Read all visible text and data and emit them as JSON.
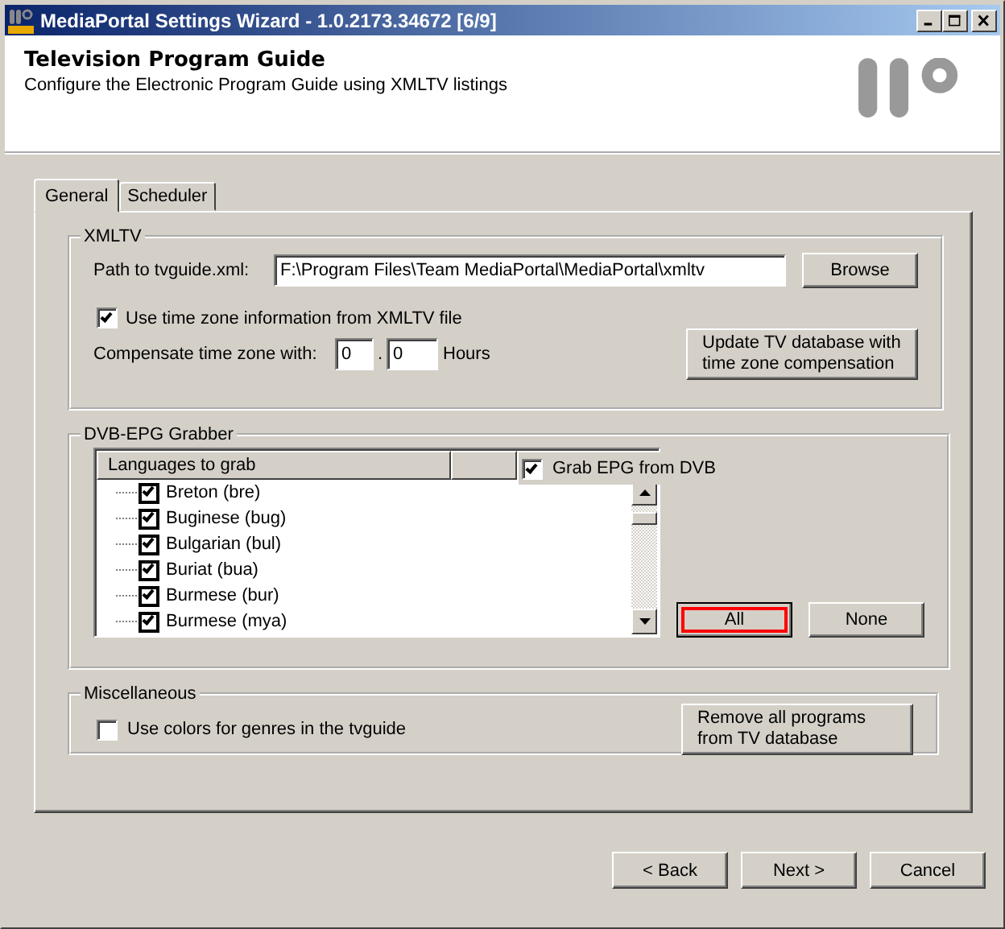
{
  "window": {
    "title": "MediaPortal Settings Wizard - 1.0.2173.34672 [6/9]"
  },
  "header": {
    "title": "Television Program Guide",
    "subtitle": "Configure the Electronic Program Guide using XMLTV listings"
  },
  "tabs": [
    {
      "label": "General",
      "selected": true
    },
    {
      "label": "Scheduler",
      "selected": false
    }
  ],
  "xmltv": {
    "legend": "XMLTV",
    "path_label": "Path to tvguide.xml:",
    "path_value": "F:\\Program Files\\Team MediaPortal\\MediaPortal\\xmltv",
    "browse_button": "Browse",
    "use_timezone": {
      "label": "Use time zone information from XMLTV file",
      "checked": true
    },
    "compensate_label": "Compensate time zone with:",
    "hours_value": "0",
    "separator": ".",
    "minutes_value": "0",
    "unit": "Hours",
    "update_button": "Update TV database with time zone compensation"
  },
  "dvb_epg": {
    "legend": "DVB-EPG Grabber",
    "column": "Languages to grab",
    "grab_epg": {
      "label": "Grab EPG from DVB",
      "checked": true
    },
    "languages": [
      {
        "name": "Breton (bre)",
        "checked": true
      },
      {
        "name": "Buginese (bug)",
        "checked": true
      },
      {
        "name": "Bulgarian (bul)",
        "checked": true
      },
      {
        "name": "Buriat (bua)",
        "checked": true
      },
      {
        "name": "Burmese (bur)",
        "checked": true
      },
      {
        "name": "Burmese (mya)",
        "checked": true
      }
    ],
    "all_button": {
      "label": "All",
      "focused": true
    },
    "none_button": {
      "label": "None",
      "focused": false
    }
  },
  "misc": {
    "legend": "Miscellaneous",
    "use_colors": {
      "label": "Use colors for genres in the tvguide",
      "checked": false
    },
    "remove_button": "Remove all programs from TV database"
  },
  "buttons": [
    "< Back",
    "Next >",
    "Cancel"
  ]
}
